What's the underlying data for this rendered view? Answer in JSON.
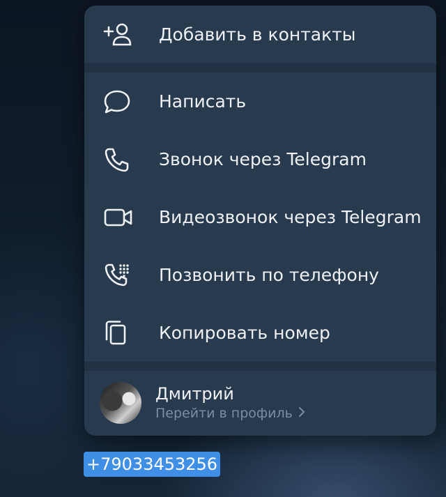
{
  "menu": {
    "add_contact": "Добавить в контакты",
    "items": [
      {
        "label": "Написать",
        "icon": "chat-bubble-icon"
      },
      {
        "label": "Звонок через Telegram",
        "icon": "phone-icon"
      },
      {
        "label": "Видеозвонок через Telegram",
        "icon": "video-camera-icon"
      },
      {
        "label": "Позвонить по телефону",
        "icon": "phone-dialpad-icon"
      },
      {
        "label": "Копировать номер",
        "icon": "copy-icon"
      }
    ]
  },
  "profile": {
    "name": "Дмитрий",
    "link": "Перейти в профиль"
  },
  "phone_number": "+79033453256",
  "colors": {
    "menu_bg": "#283a4d",
    "text": "#eef2f6",
    "subtext": "#7a8ea3",
    "highlight": "#3f8fe6"
  }
}
